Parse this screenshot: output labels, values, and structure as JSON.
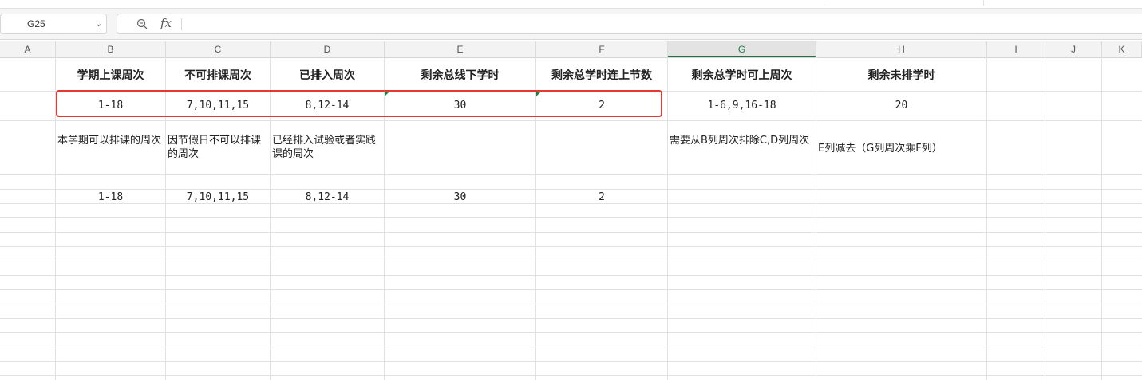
{
  "name_box": {
    "value": "G25"
  },
  "formula_bar": {
    "fx_label": "fx",
    "content": ""
  },
  "columns": [
    {
      "label": "A"
    },
    {
      "label": "B"
    },
    {
      "label": "C"
    },
    {
      "label": "D"
    },
    {
      "label": "E"
    },
    {
      "label": "F"
    },
    {
      "label": "G",
      "active": true
    },
    {
      "label": "H"
    },
    {
      "label": "I"
    },
    {
      "label": "J"
    },
    {
      "label": "K"
    }
  ],
  "rows": {
    "header": {
      "B": "学期上课周次",
      "C": "不可排课周次",
      "D": "已排入周次",
      "E": "剩余总线下学时",
      "F": "剩余总学时连上节数",
      "G": "剩余总学时可上周次",
      "H": "剩余未排学时"
    },
    "values": {
      "B": "1-18",
      "C": "7,10,11,15",
      "D": "8,12-14",
      "E": "30",
      "F": "2",
      "G": "1-6,9,16-18",
      "H": "20"
    },
    "notes": {
      "B": "本学期可以排课的周次",
      "C": "因节假日不可以排课的周次",
      "D": "已经排入试验或者实践课的周次",
      "G": "需要从B列周次排除C,D列周次",
      "H": "E列减去（G列周次乘F列）"
    },
    "values2": {
      "B": "1-18",
      "C": "7,10,11,15",
      "D": "8,12-14",
      "E": "30",
      "F": "2"
    }
  },
  "colors": {
    "accent": "#217346",
    "highlight": "#e53935",
    "comment_marker": "#1e7e45"
  }
}
